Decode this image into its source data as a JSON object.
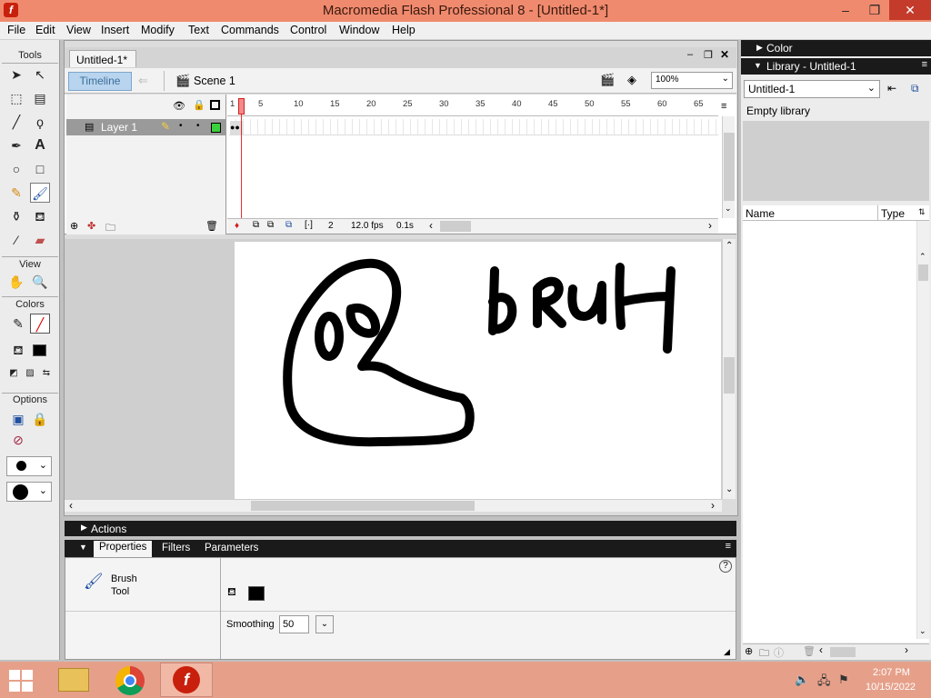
{
  "window": {
    "title": "Macromedia Flash Professional 8 - [Untitled-1*]",
    "app_icon": "f",
    "controls": {
      "minimize": "–",
      "restore": "❐",
      "close": "✕"
    }
  },
  "menu": [
    "File",
    "Edit",
    "View",
    "Insert",
    "Modify",
    "Text",
    "Commands",
    "Control",
    "Window",
    "Help"
  ],
  "tools_panel": {
    "tools_label": "Tools",
    "view_label": "View",
    "colors_label": "Colors",
    "options_label": "Options"
  },
  "document": {
    "tab_label": "Untitled-1*",
    "timeline_button": "Timeline",
    "scene_label": "Scene 1",
    "zoom_value": "100%"
  },
  "timeline": {
    "ruler_ticks": [
      "1",
      "5",
      "10",
      "15",
      "20",
      "25",
      "30",
      "35",
      "40",
      "45",
      "50",
      "55",
      "60",
      "65"
    ],
    "layer_name": "Layer 1",
    "current_frame": "2",
    "frame_rate": "12.0 fps",
    "elapsed": "0.1s"
  },
  "stage": {
    "drawn_text": "bRUH"
  },
  "actions_panel": {
    "label": "Actions"
  },
  "properties_panel": {
    "tabs": [
      "Properties",
      "Filters",
      "Parameters"
    ],
    "tool_line1": "Brush",
    "tool_line2": "Tool",
    "smoothing_label": "Smoothing",
    "smoothing_value": "50",
    "help_icon": "?"
  },
  "right_panels": {
    "color_label": "Color",
    "library_label": "Library - Untitled-1",
    "library_doc": "Untitled-1",
    "empty_text": "Empty library",
    "col_name": "Name",
    "col_type": "Type"
  },
  "taskbar": {
    "time": "2:07 PM",
    "date": "10/15/2022"
  },
  "colors": {
    "title_bar": "#f08a6e",
    "taskbar": "#e6a08a",
    "panel_header": "#1a1a1a",
    "timeline_button": "#b8d4ee",
    "playhead": "#e03030"
  }
}
